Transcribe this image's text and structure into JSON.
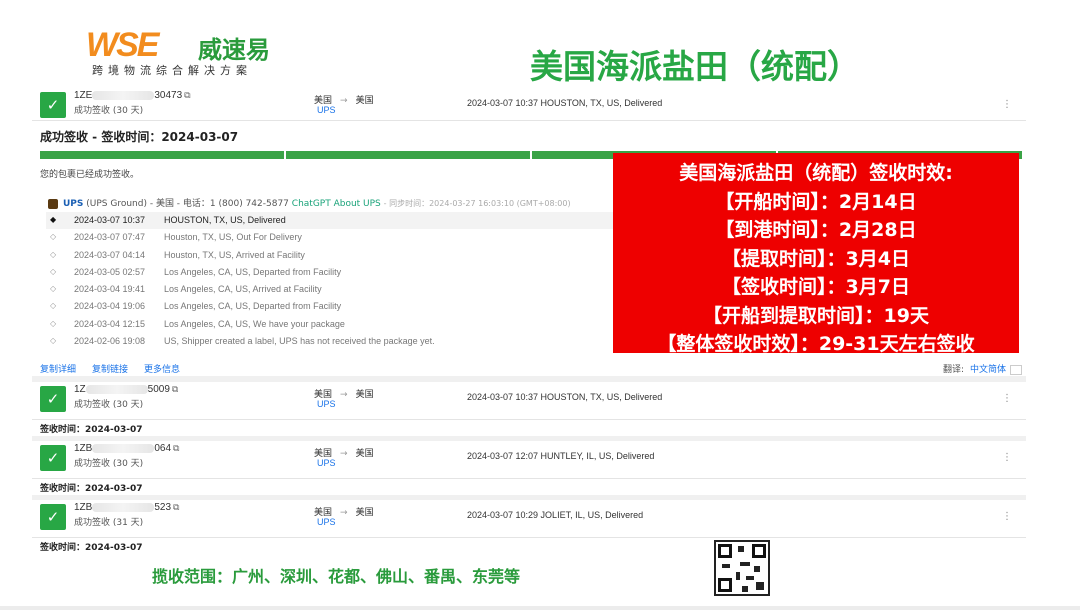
{
  "header": {
    "logo_mark": "WSE",
    "logo_cn": "威速易",
    "logo_sub": "跨境物流综合解决方案",
    "page_title": "美国海派盐田（统配）"
  },
  "shipments": [
    {
      "tracking_prefix": "1ZE",
      "tracking_suffix": "30473",
      "status": "成功签收 (30 天)",
      "origin": "美国",
      "carrier": "UPS",
      "dest": "美国",
      "latest": "2024-03-07 10:37  HOUSTON, TX, US, Delivered"
    },
    {
      "tracking_prefix": "1Z",
      "tracking_suffix": "5009",
      "status": "成功签收 (30 天)",
      "origin": "美国",
      "carrier": "UPS",
      "dest": "美国",
      "latest": "2024-03-07 10:37  HOUSTON, TX, US, Delivered",
      "sign_time": "签收时间：2024-03-07"
    },
    {
      "tracking_prefix": "1ZB",
      "tracking_suffix": "064",
      "status": "成功签收 (30 天)",
      "origin": "美国",
      "carrier": "UPS",
      "dest": "美国",
      "latest": "2024-03-07 12:07  HUNTLEY, IL, US, Delivered",
      "sign_time": "签收时间：2024-03-07"
    },
    {
      "tracking_prefix": "1ZB",
      "tracking_suffix": "523",
      "status": "成功签收 (31 天)",
      "origin": "美国",
      "carrier": "UPS",
      "dest": "美国",
      "latest": "2024-03-07 10:29  JOLIET, IL, US, Delivered",
      "sign_time": "签收时间：2024-03-07"
    }
  ],
  "copy_glyph": "⧉",
  "more_glyph": "⋮",
  "check_glyph": "✓",
  "arrow_glyph": "→",
  "detail": {
    "title": "成功签收 - 签收时间：2024-03-07",
    "delivered_msg": "您的包裹已经成功签收。",
    "carrier_name": "UPS",
    "carrier_info": "(UPS Ground) - 美国 - 电话：1 (800) 742-5877",
    "chatgpt": "ChatGPT About UPS",
    "sync": "- 同步时间：2024-03-27 16:03:10 (GMT+08:00)",
    "events": [
      {
        "time": "2024-03-07 10:37",
        "desc": "HOUSTON, TX, US, Delivered"
      },
      {
        "time": "2024-03-07 07:47",
        "desc": "Houston, TX, US, Out For Delivery"
      },
      {
        "time": "2024-03-07 04:14",
        "desc": "Houston, TX, US, Arrived at Facility"
      },
      {
        "time": "2024-03-05 02:57",
        "desc": "Los Angeles, CA, US, Departed from Facility"
      },
      {
        "time": "2024-03-04 19:41",
        "desc": "Los Angeles, CA, US, Arrived at Facility"
      },
      {
        "time": "2024-03-04 19:06",
        "desc": "Los Angeles, CA, US, Departed from Facility"
      },
      {
        "time": "2024-03-04 12:15",
        "desc": "Los Angeles, CA, US, We have your package"
      },
      {
        "time": "2024-02-06 19:08",
        "desc": "US, Shipper created a label, UPS has not received the package yet."
      }
    ],
    "links": [
      "复制详细",
      "复制链接",
      "更多信息"
    ],
    "translate_label": "翻译:",
    "translate_value": "中文简体"
  },
  "overlay": {
    "lines": [
      "美国海派盐田（统配）签收时效:",
      "【开船时间】：2月14日",
      "【到港时间】：2月28日",
      "【提取时间】：3月4日",
      "【签收时间】：3月7日",
      "【开船到提取时间】：19天",
      "【整体签收时效】：29-31天左右签收"
    ]
  },
  "footer": {
    "coverage": "揽收范围：广州、深圳、花都、佛山、番禺、东莞等"
  },
  "colors": {
    "brand_green": "#2a9b3c",
    "brand_orange": "#f28c1e",
    "overlay_red": "#ee0000",
    "status_green": "#28a745"
  }
}
